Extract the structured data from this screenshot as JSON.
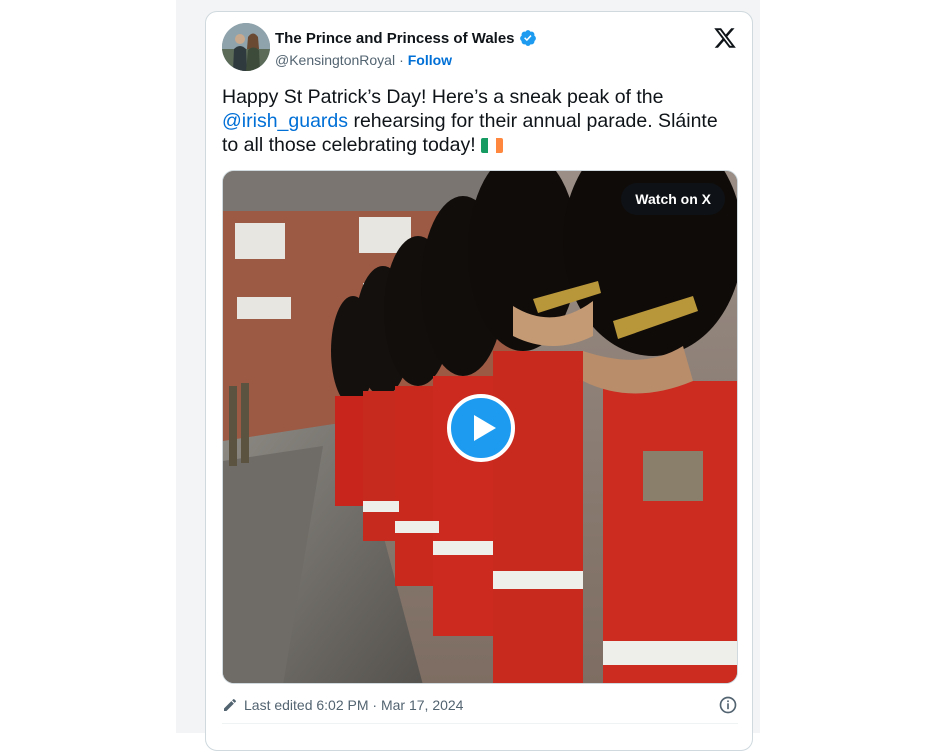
{
  "author": {
    "display_name": "The Prince and Princess of Wales",
    "handle": "@KensingtonRoyal",
    "separator": "·",
    "follow_label": "Follow",
    "verified": true
  },
  "tweet": {
    "text_before": "Happy St Patrick’s Day! Here’s a sneak peak of the ",
    "mention": "@irish_guards",
    "text_after": " rehearsing for their annual parade. Sláinte to all those celebrating today! ",
    "flag_emoji": "irish-flag-icon"
  },
  "media": {
    "watch_label": "Watch on X",
    "type": "video"
  },
  "footer": {
    "edited_text": "Last edited 6:02 PM · Mar 17, 2024"
  },
  "colors": {
    "accent": "#1d9bf0",
    "link": "#006fd6",
    "secondary_text": "#536471",
    "border": "#cfd9de"
  }
}
